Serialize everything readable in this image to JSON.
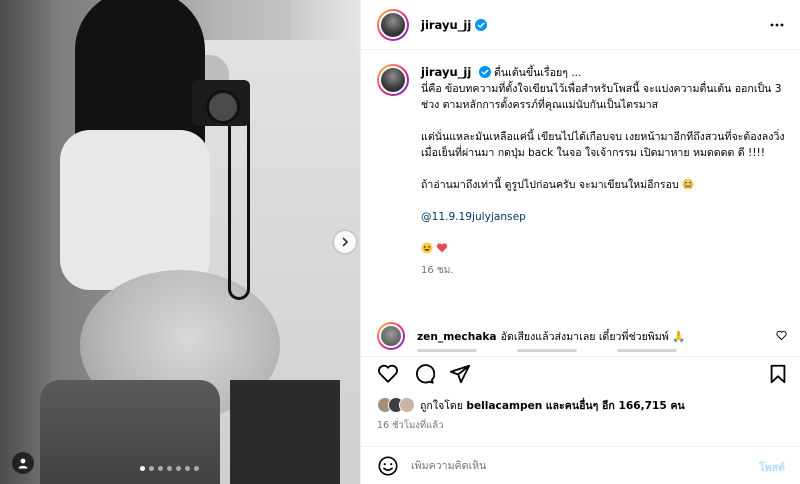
{
  "post": {
    "author": "jirayu_jj",
    "more_icon": "more-horizontal-icon",
    "carousel": {
      "slide_count": 7,
      "active_index": 0,
      "next_icon": "chevron-right-icon",
      "user_tag_icon": "person-icon"
    }
  },
  "caption": {
    "author": "jirayu_jj",
    "lines": [
      "ตื่นเต้นขึ้นเรื่อยๆ ...",
      "นี่คือ ข้อบทความที่ตั้งใจเขียนไว้เพื่อสำหรับโพสนี้ จะแบ่งความตื่นเต้น ออกเป็น 3 ช่วง ตามหลักการตั้งครรภ์ที่คุณแม่นับกันเป็นไตรมาส",
      "แต่นั่นแหละมันเหลือแค่นี้ เขียนไปได้เกือบจบ เงยหน้ามาอีกทีถึงสวนที่จะต้องลงวิ่งเมื่อเย็นที่ผ่านมา กดปุ่ม back ในจอ ใจเจ้ากรรม เปิดมาหาย หมดดดด ดี !!!!",
      "ถ้าอ่านมาถึงเท่านี้ ดูรูปไปก่อนครับ จะมาเขียนใหม่อีกรอบ",
      "@11.9.19julyjansep"
    ],
    "timestamp": "16 ชม."
  },
  "comment": {
    "author": "zen_mechaka",
    "text": "อัดเสียงแล้วส่งมาเลย เดี๋ยวพี่ช่วยพิมพ์ 🙏"
  },
  "actions": {
    "like_icon": "heart-outline-icon",
    "comment_icon": "comment-bubble-icon",
    "share_icon": "paper-plane-icon",
    "save_icon": "bookmark-icon"
  },
  "likes": {
    "prefix": "ถูกใจโดย",
    "user": "bellacampen",
    "middle": "และ",
    "others": "คนอื่นๆ อีก 166,715 คน"
  },
  "post_time": "16 ชั่วโมงที่แล้ว",
  "add_comment": {
    "placeholder": "เพิ่มความคิดเห็น",
    "post_label": "โพสต์",
    "emoji_icon": "smile-icon"
  },
  "colors": {
    "link": "#00376b",
    "verified": "#0095f6",
    "muted": "#737373",
    "post_button_disabled": "#b2dffc",
    "heart": "#ed4956"
  }
}
